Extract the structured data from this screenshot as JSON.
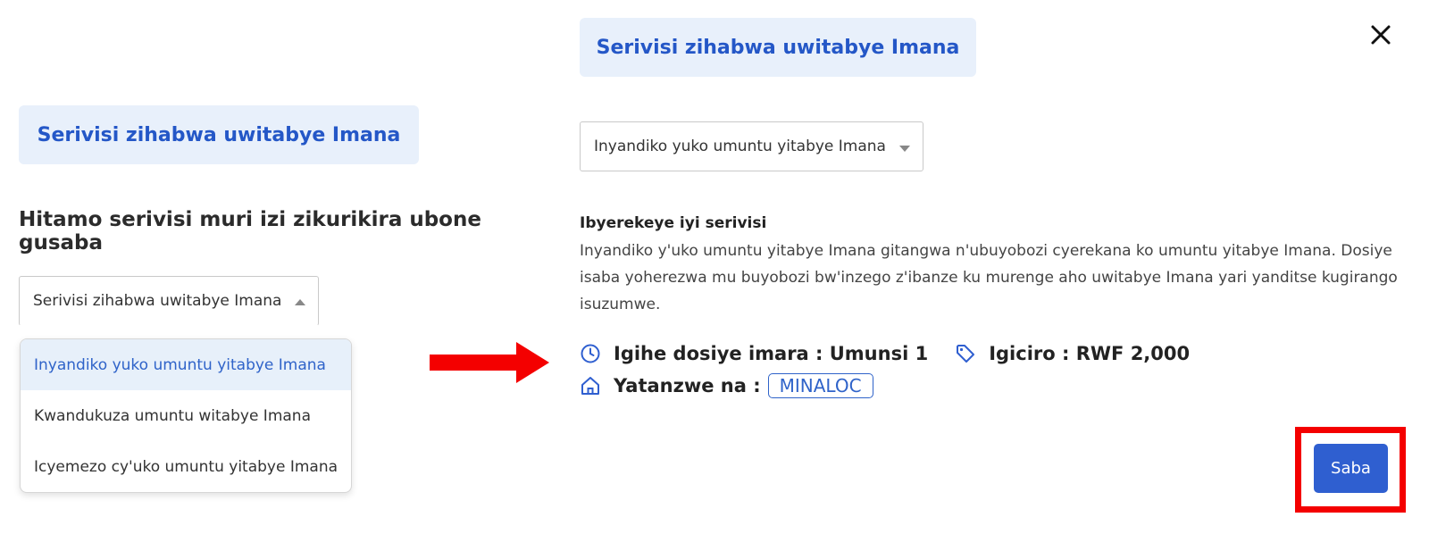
{
  "left": {
    "badge": "Serivisi zihabwa uwitabye Imana",
    "heading": "Hitamo serivisi muri izi zikurikira ubone gusaba",
    "select_value": "Serivisi zihabwa uwitabye Imana",
    "options": [
      "Inyandiko yuko umuntu yitabye Imana",
      "Kwandukuza umuntu witabye Imana",
      "Icyemezo cy'uko umuntu yitabye Imana"
    ]
  },
  "right": {
    "badge": "Serivisi zihabwa uwitabye Imana",
    "select_value": "Inyandiko yuko umuntu yitabye Imana",
    "about_title": "Ibyerekeye iyi serivisi",
    "about_body": "Inyandiko y'uko umuntu yitabye Imana gitangwa n'ubuyobozi cyerekana ko umuntu yitabye Imana. Dosiye isaba yoherezwa mu buyobozi bw'inzego z'ibanze ku murenge aho uwitabye Imana yari yanditse kugirango isuzumwe.",
    "duration_label": "Igihe dosiye imara : Umunsi 1",
    "price_label": "Igiciro : RWF 2,000",
    "provider_label": "Yatanzwe na :",
    "provider_value": "MINALOC",
    "submit_label": "Saba"
  },
  "colors": {
    "accent": "#2f5fd0",
    "badge_bg": "#e8f0fb",
    "highlight": "#f40000",
    "arrow": "#f40000"
  },
  "icons": {
    "close": "close-icon",
    "clock": "clock-icon",
    "tag": "tag-icon",
    "home": "home-icon",
    "arrow": "arrow-right-icon"
  }
}
